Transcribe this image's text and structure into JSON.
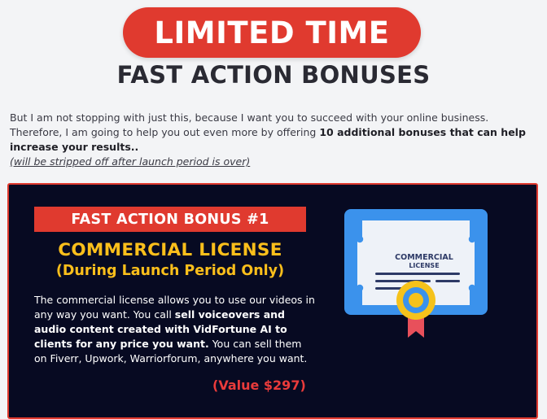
{
  "header": {
    "limited_label": "LIMITED TIME",
    "title": "FAST ACTION BONUSES"
  },
  "intro": {
    "text_before": "But I am not stopping with just this, because I want you to succeed with your online business. Therefore, I am going to help you out even more by offering ",
    "bold_text": "10 additional bonuses that can help increase your results..",
    "note": "(will be stripped off after launch period is over)"
  },
  "bonus": {
    "badge": "FAST ACTION BONUS #1",
    "title": "COMMERCIAL LICENSE",
    "subtitle": "(During Launch Period Only)",
    "desc_part1": "The commercial license allows you to use our videos in any way you want. You call ",
    "desc_bold": "sell voiceovers and audio content created with VidFortune AI to clients for any price you want.",
    "desc_part2": " You can sell them on Fiverr, Upwork, Warriorforum, anywhere you want.",
    "value": "(Value $297)",
    "icon": "certificate-icon",
    "icon_text_line1": "COMMERCIAL",
    "icon_text_line2": "LICENSE"
  },
  "colors": {
    "accent_red": "#e03a2f",
    "card_bg": "#070a22",
    "gold": "#fbbf1b",
    "value_red": "#ea3b3b",
    "cert_blue": "#3b92ec"
  }
}
